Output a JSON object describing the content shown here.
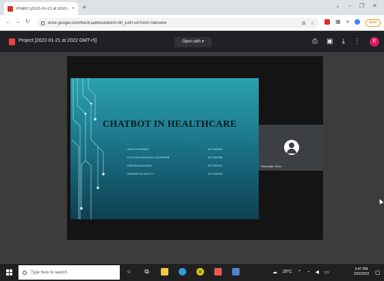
{
  "browser": {
    "tab_title": "Project [2022-01-21 at 2022-...",
    "tab_close": "×",
    "new_tab": "+",
    "window_controls": [
      "⌄",
      "–",
      "❐",
      "✕"
    ],
    "url": "drive.google.com/file/d/1a8b5c6d9e0f-Wf_EdH-5IPGfsh7fde/view",
    "profile_badge": "Error"
  },
  "viewer": {
    "file_title": "Project [2022-01-21 at 2022 GMT+5]",
    "open_with_label": "Open with ▾",
    "header_icons": [
      "print-icon",
      "add-comment-icon",
      "download-icon",
      "more-icon"
    ],
    "account_initial": "E"
  },
  "slide": {
    "title": "CHATBOT IN HEALTHCARE",
    "members": [
      {
        "name": "ADITYA PRASAD",
        "id": "1ET18IS001"
      },
      {
        "name": "B S SHIVU BHAGATH JAYAPRAB",
        "id": "1ET18IS005"
      },
      {
        "name": "DEEPANJAN SHAH",
        "id": "1ET18IS011"
      },
      {
        "name": "HARSHITHA SHETTY",
        "id": "1ET18IS024"
      }
    ]
  },
  "meeting": {
    "participant_name": "Deepanjan Shah"
  },
  "taskbar": {
    "search_placeholder": "Type here to search",
    "weather": "29°C",
    "time": "5:47 PM",
    "date": "2/22/2022",
    "colors": {
      "explorer": "#f2c94c",
      "edge": "#2d9cdb",
      "chrome": "#34a853",
      "office": "#eb5757",
      "store": "#4f83cc"
    }
  }
}
